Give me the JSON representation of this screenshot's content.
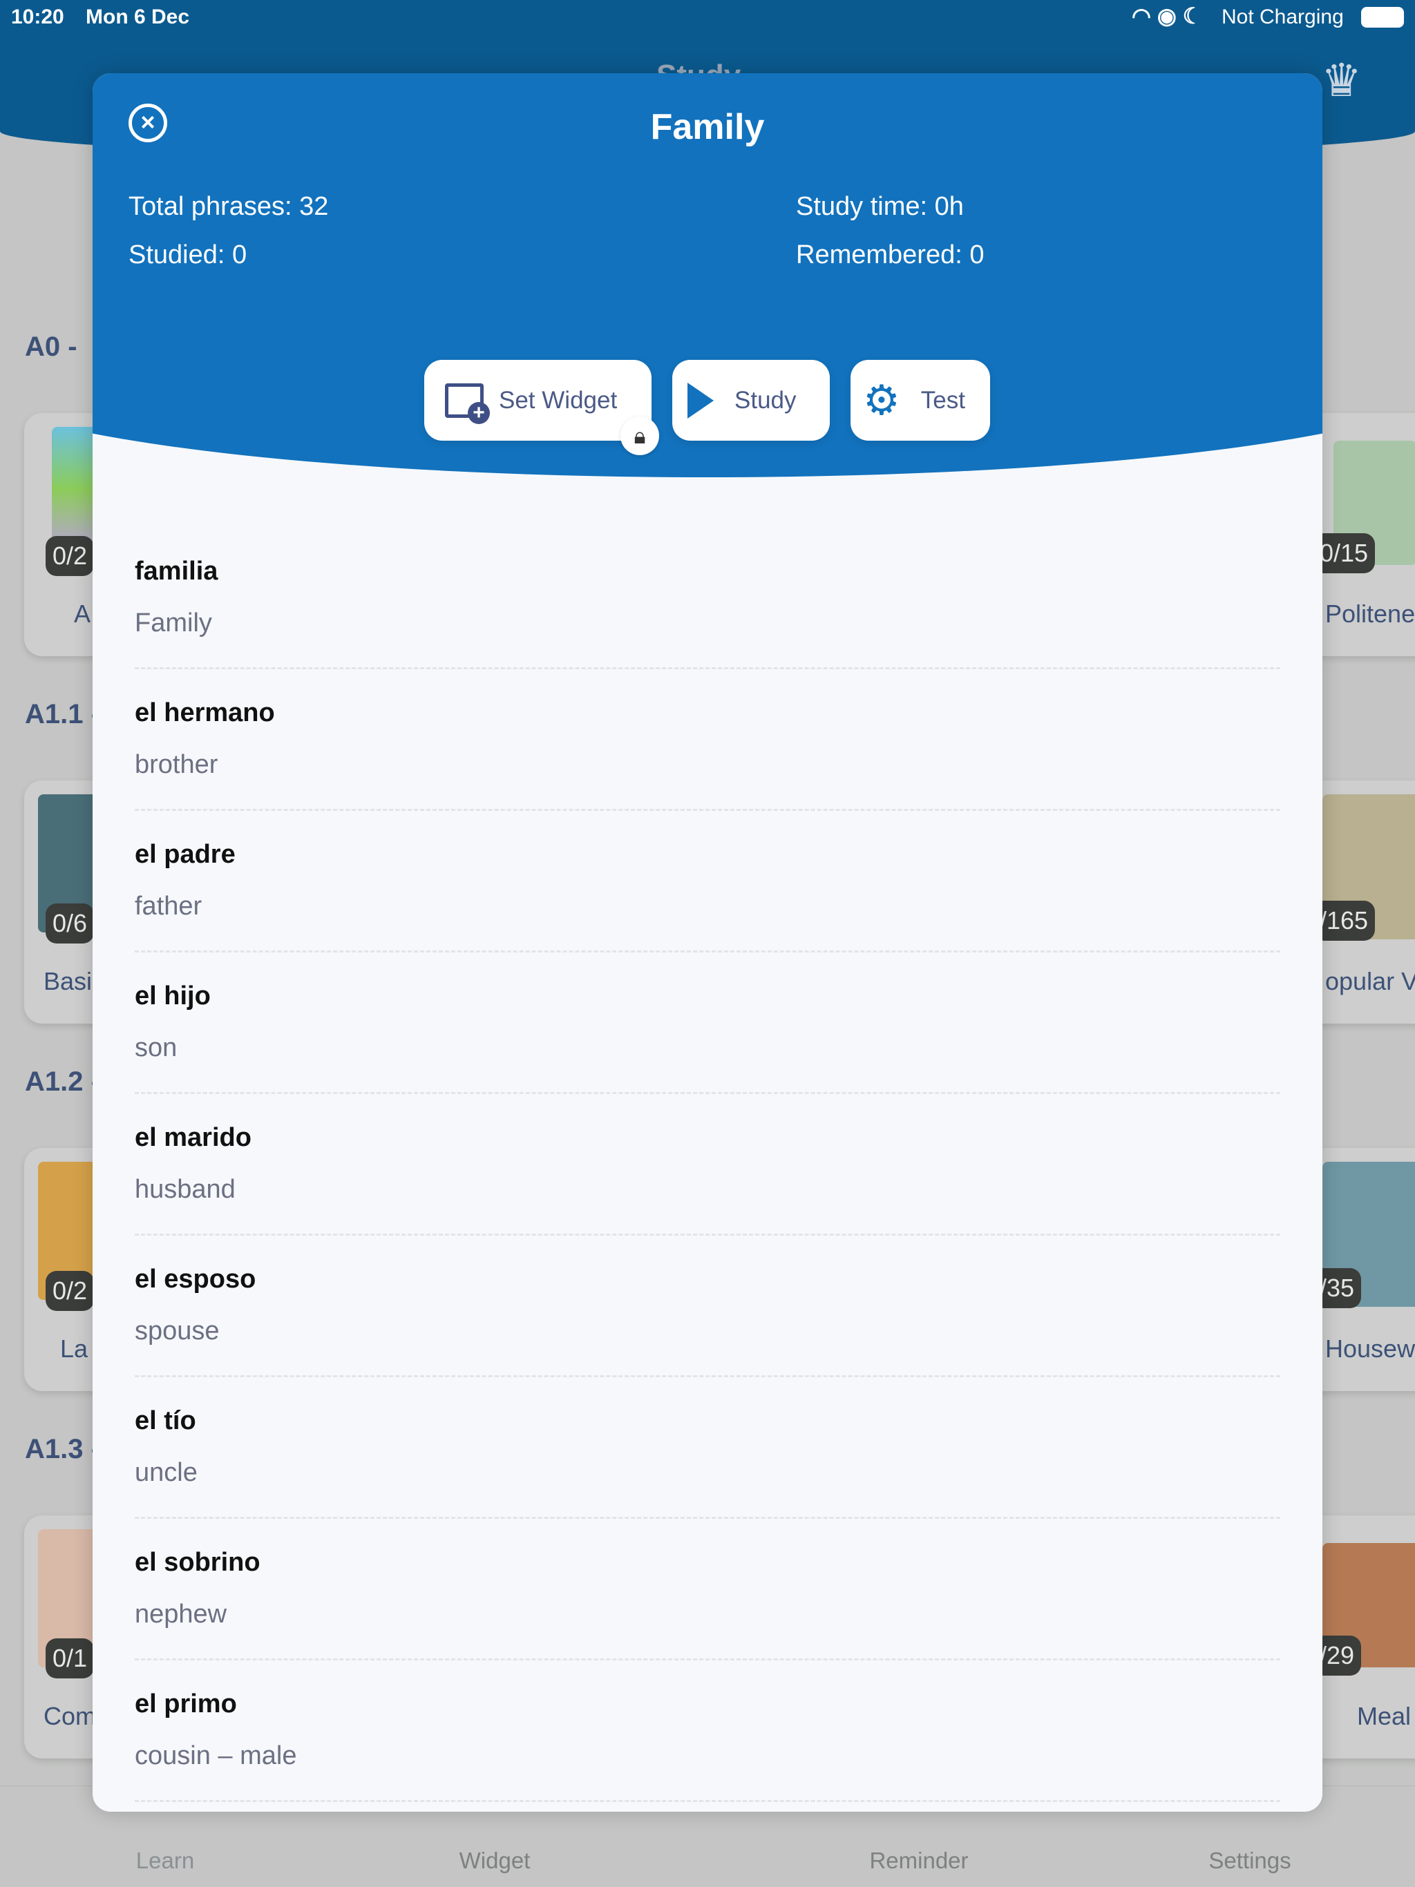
{
  "status_bar": {
    "time": "10:20",
    "date": "Mon 6 Dec",
    "charging": "Not Charging"
  },
  "app": {
    "title": "Study"
  },
  "sections": [
    "A0 -",
    "A1.1 -",
    "A1.2 -",
    "A1.3 -"
  ],
  "left_cards": [
    {
      "count": "0/2",
      "label": "A"
    },
    {
      "count": "0/6",
      "label": "Basi"
    },
    {
      "count": "0/2",
      "label": "La"
    },
    {
      "count": "0/1",
      "label": "Com"
    }
  ],
  "right_cards": [
    {
      "count": "0/15",
      "label": "Politene"
    },
    {
      "count": "/165",
      "label": "opular V"
    },
    {
      "count": "/35",
      "label": "Housew"
    },
    {
      "count": "/29",
      "label": "Meal"
    }
  ],
  "modal": {
    "title": "Family",
    "total_phrases": "Total phrases: 32",
    "studied": "Studied: 0",
    "study_time": "Study time: 0h",
    "remembered": "Remembered: 0",
    "buttons": {
      "set_widget": "Set Widget",
      "study": "Study",
      "test": "Test"
    },
    "accent": "#1272bd",
    "phrases": [
      {
        "term": "familia",
        "translation": "Family"
      },
      {
        "term": "el hermano",
        "translation": "brother"
      },
      {
        "term": "el padre",
        "translation": "father"
      },
      {
        "term": "el hijo",
        "translation": "son"
      },
      {
        "term": "el marido",
        "translation": "husband"
      },
      {
        "term": "el esposo",
        "translation": "spouse"
      },
      {
        "term": "el tío",
        "translation": "uncle"
      },
      {
        "term": "el sobrino",
        "translation": "nephew"
      },
      {
        "term": "el primo",
        "translation": "cousin – male"
      }
    ]
  },
  "tabs": [
    {
      "label": "Learn",
      "icon": "book-icon"
    },
    {
      "label": "Widget",
      "icon": "layers-icon"
    },
    {
      "label": "Reminder",
      "icon": "bell-icon"
    },
    {
      "label": "Settings",
      "icon": "dots-icon"
    }
  ]
}
